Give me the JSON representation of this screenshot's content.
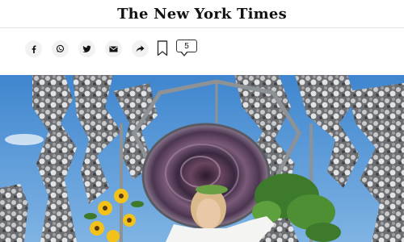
{
  "masthead": {
    "logo_text": "The New York Times"
  },
  "share_bar": {
    "buttons": [
      {
        "name": "facebook",
        "icon": "facebook-icon"
      },
      {
        "name": "whatsapp",
        "icon": "whatsapp-icon"
      },
      {
        "name": "twitter",
        "icon": "twitter-icon"
      },
      {
        "name": "email",
        "icon": "email-icon"
      },
      {
        "name": "share",
        "icon": "share-arrow-icon"
      }
    ],
    "save_icon": "bookmark-icon",
    "comments_count": "5"
  },
  "colors": {
    "text": "#121212",
    "button_bg": "#f2f2f2",
    "sky": "#4f8fd0",
    "divider": "#e2e2e2"
  }
}
